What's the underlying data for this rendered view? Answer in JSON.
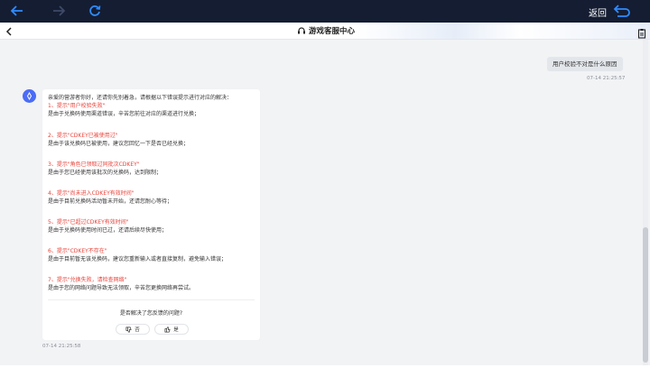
{
  "topbar": {
    "return_label": "返回"
  },
  "subbar": {
    "title": "游戏客服中心"
  },
  "chat": {
    "user_message": "用户校验不对是什么原因",
    "user_time": "07-14 21:25:57",
    "bot_intro": "亲爱的营游者你好，还请你先别着急，请根据以下错误提示进行对应的解决：",
    "items": [
      {
        "title": "1、提示\"用户校验失败\"",
        "desc": "是由于兑换码使用渠道错误，辛苦您前往对应的渠道进行兑换；"
      },
      {
        "title": "2、提示\"CDKEY已被使用过\"",
        "desc": "是由于该兑换码已被使用，建议您回忆一下是否已经兑换；"
      },
      {
        "title": "3、提示\"角色已领取过同批次CDKEY\"",
        "desc": "是由于您已经使用该批次的兑换码，达到限制；"
      },
      {
        "title": "4、提示\"尚未进入CDKEY有效时间\"",
        "desc": "是由于目前兑换码活动暂未开始，还请您耐心等待；"
      },
      {
        "title": "5、提示\"已超过CDKEY有效时间\"",
        "desc": "是由于兑换码使用时间已过，还请后续尽快使用；"
      },
      {
        "title": "6、提示\"CDKEY不存在\"",
        "desc": "是由于目前暂无该兑换码，建议您重新输入或者直接复制，避免输入错误；"
      },
      {
        "title": "7、提示\"兑换失败，请检查网络\"",
        "desc": "是由于您的网络问题导致无法领取，辛苦您更换网络再尝试。"
      }
    ],
    "feedback_question": "是否解决了您反馈的问题?",
    "feedback_no": "否",
    "feedback_yes": "是",
    "bot_time": "07-14 21:25:58"
  },
  "colors": {
    "topbar": "#151d33",
    "accent": "#4b6cf6",
    "highlight": "#e8433a"
  }
}
